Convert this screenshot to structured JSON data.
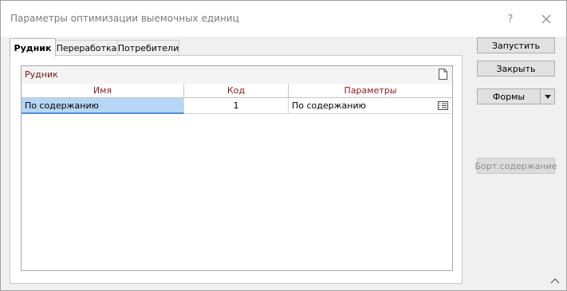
{
  "window": {
    "title": "Параметры оптимизации выемочных единиц",
    "help_label": "?"
  },
  "tabs": [
    {
      "label": "Рудник",
      "active": true
    },
    {
      "label": "Переработка",
      "active": false
    },
    {
      "label": "Потребители",
      "active": false
    }
  ],
  "grid": {
    "caption": "Рудник",
    "columns": [
      "Имя",
      "Код",
      "Параметры"
    ],
    "rows": [
      {
        "name": "По содержанию",
        "code": "1",
        "params": "По содержанию"
      }
    ]
  },
  "buttons": {
    "run": "Запустить",
    "close": "Закрыть",
    "forms": "Формы",
    "cutoff": "Борт.содержание"
  },
  "colors": {
    "header_text": "#8b1a1a",
    "selection": "#b6d6f5",
    "selection_border": "#4f8fd9"
  },
  "icons": [
    "close-icon",
    "document-icon",
    "list-icon",
    "dropdown-arrow-icon",
    "chevron-up-icon"
  ]
}
